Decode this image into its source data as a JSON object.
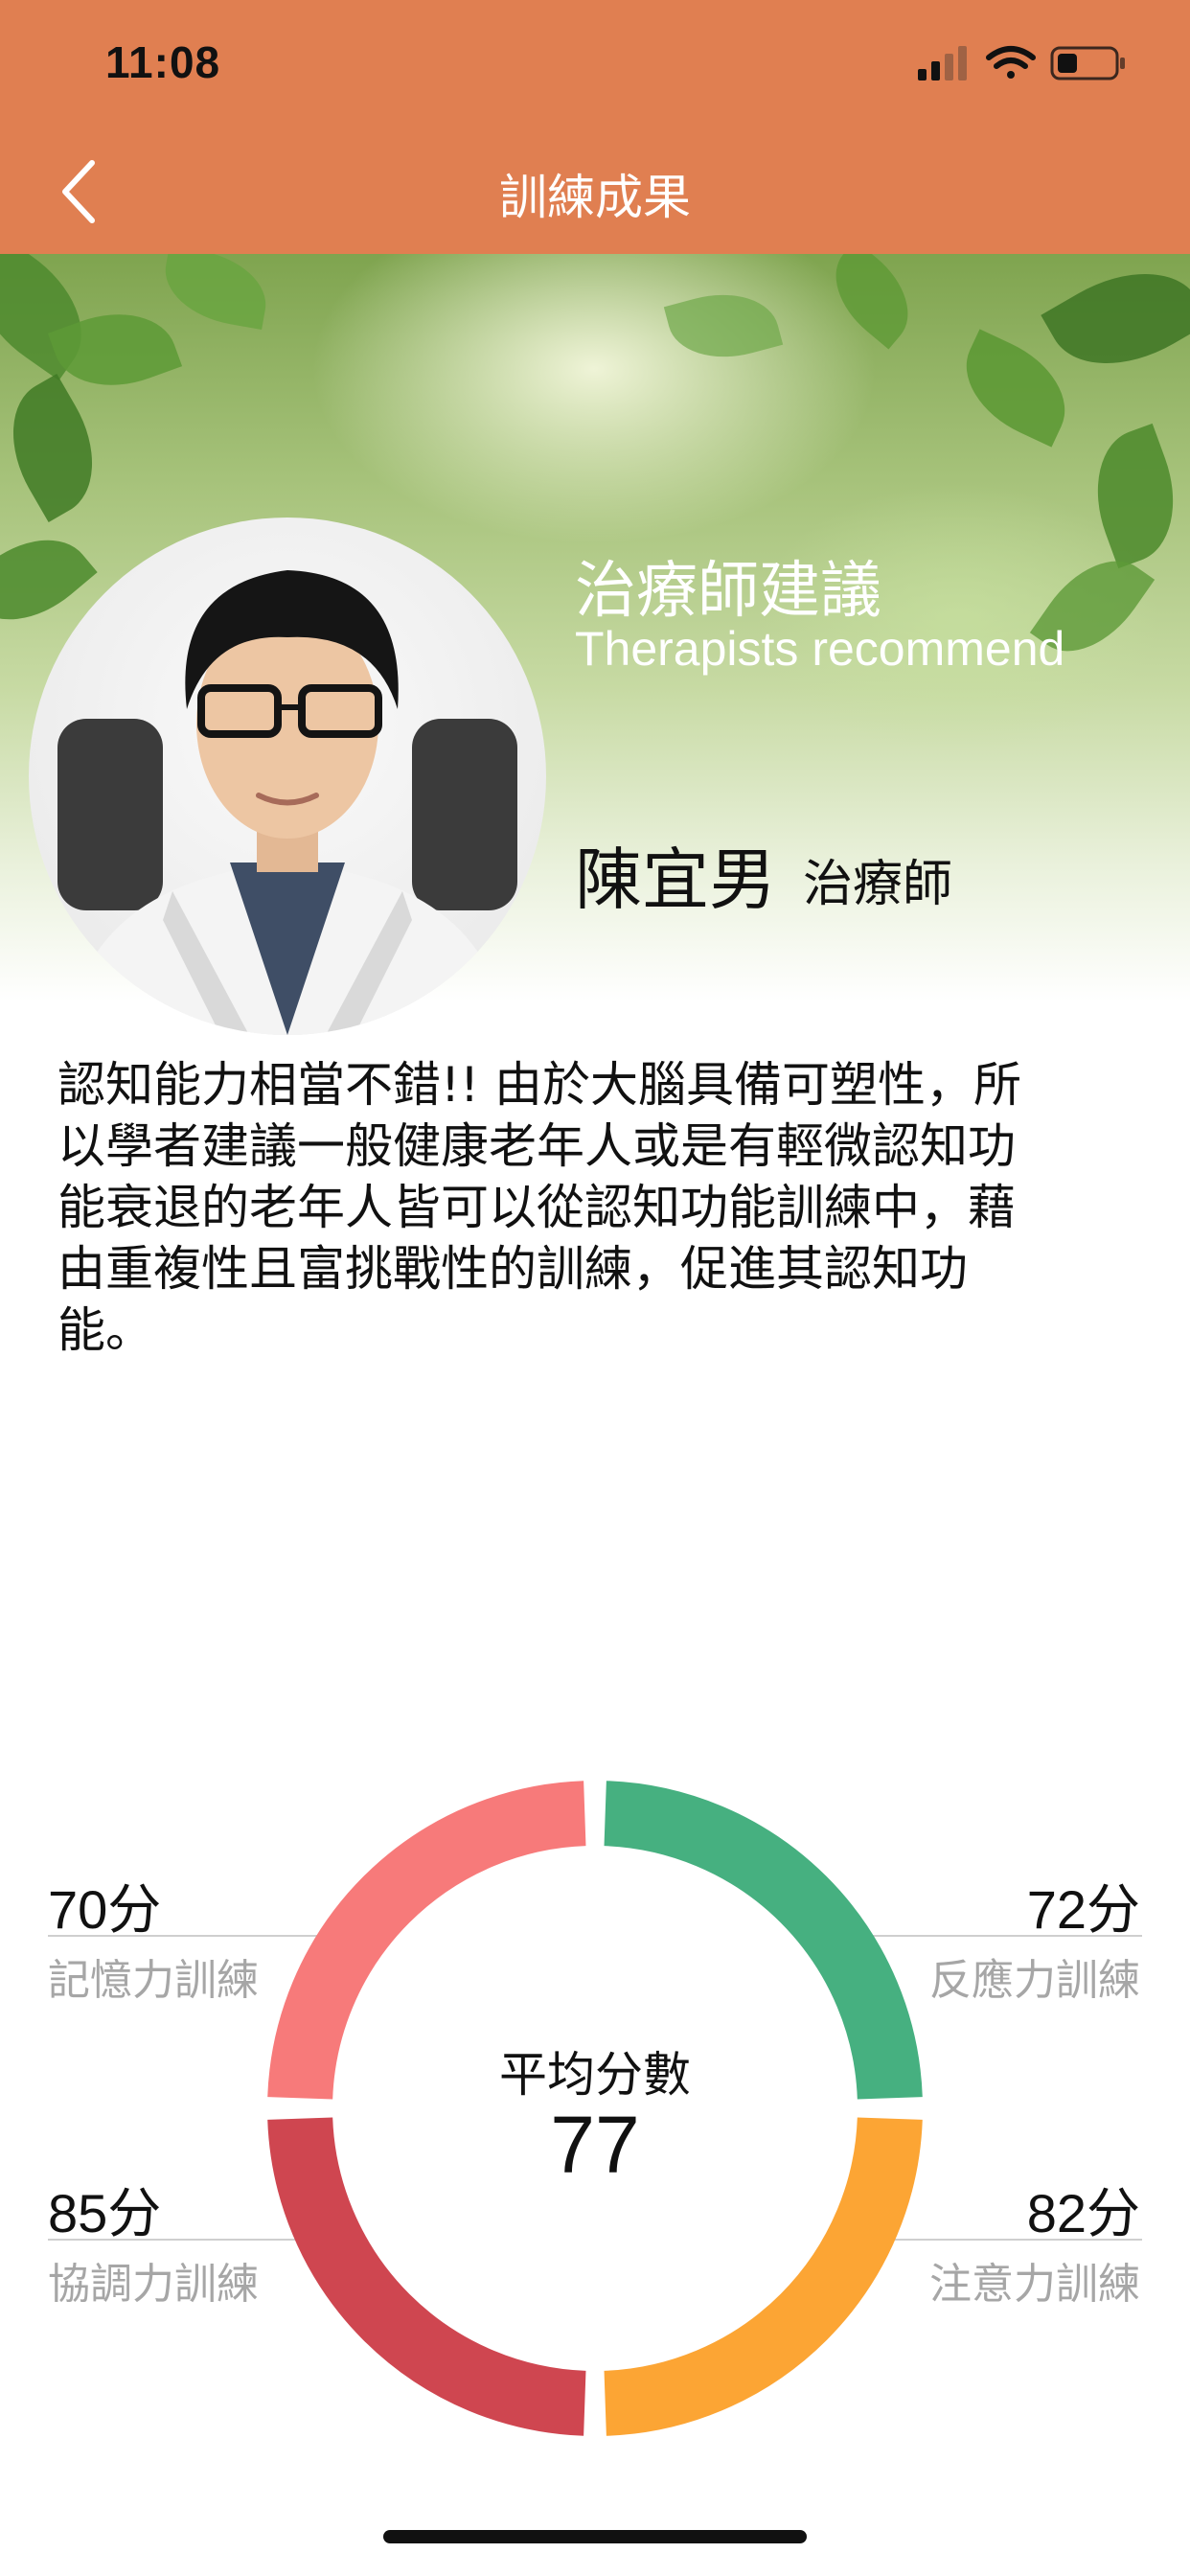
{
  "status_bar": {
    "time": "11:08"
  },
  "nav": {
    "title": "訓練成果",
    "back_icon": "chevron-left-icon"
  },
  "banner": {
    "title": "治療師建議",
    "subtitle": "Therapists recommend",
    "therapist_name": "陳宜男",
    "therapist_role": "治療師"
  },
  "advice_lines": [
    "認知能力相當不錯!! 由於大腦具備可塑性，所",
    "以學者建議一般健康老年人或是有輕微認知功",
    "能衰退的老年人皆可以從認知功能訓練中，藉",
    "由重複性且富挑戰性的訓練，促進其認知功",
    "能。"
  ],
  "scores": {
    "memory": {
      "value": "70分",
      "label": "記憶力訓練"
    },
    "reaction": {
      "value": "72分",
      "label": "反應力訓練"
    },
    "coordination": {
      "value": "85分",
      "label": "協調力訓練"
    },
    "attention": {
      "value": "82分",
      "label": "注意力訓練"
    },
    "average_label": "平均分數",
    "average_value": "77"
  },
  "colors": {
    "header": "#e07f51",
    "memory": "#f77a7a",
    "reaction": "#46b080",
    "coordination": "#cf4650",
    "attention": "#fca534"
  }
}
